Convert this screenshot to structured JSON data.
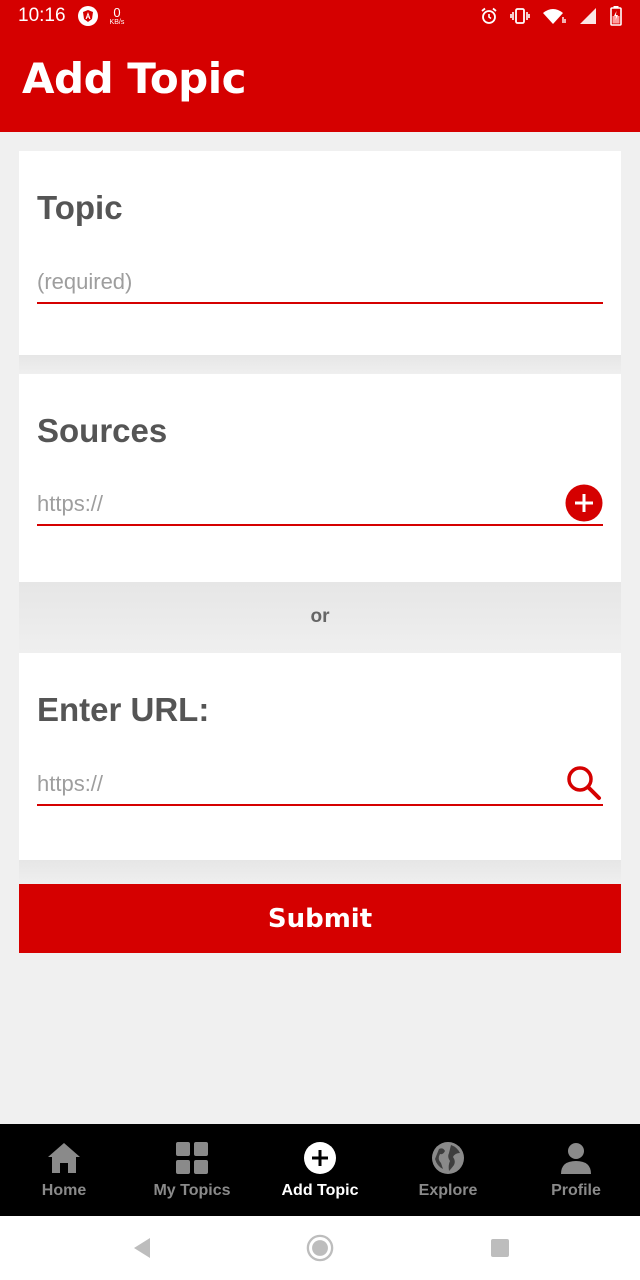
{
  "status_bar": {
    "time": "10:16",
    "net_speed_value": "0",
    "net_speed_unit": "KB/s"
  },
  "app_bar": {
    "title": "Add Topic"
  },
  "topic_card": {
    "heading": "Topic",
    "placeholder": "(required)",
    "value": ""
  },
  "sources_card": {
    "heading": "Sources",
    "placeholder": "https://",
    "value": "",
    "action_icon": "add-circle-icon"
  },
  "divider": {
    "text": "or"
  },
  "url_card": {
    "heading": "Enter URL:",
    "placeholder": "https://",
    "value": "",
    "action_icon": "search-icon"
  },
  "submit": {
    "label": "Submit"
  },
  "bottom_nav": {
    "items": [
      {
        "label": "Home",
        "icon": "home-icon",
        "active": false
      },
      {
        "label": "My Topics",
        "icon": "grid-icon",
        "active": false
      },
      {
        "label": "Add Topic",
        "icon": "add-circle-icon",
        "active": true
      },
      {
        "label": "Explore",
        "icon": "globe-icon",
        "active": false
      },
      {
        "label": "Profile",
        "icon": "person-icon",
        "active": false
      }
    ]
  },
  "colors": {
    "accent": "#d50000",
    "nav_background": "#000000",
    "page_background": "#f0f0f0"
  }
}
